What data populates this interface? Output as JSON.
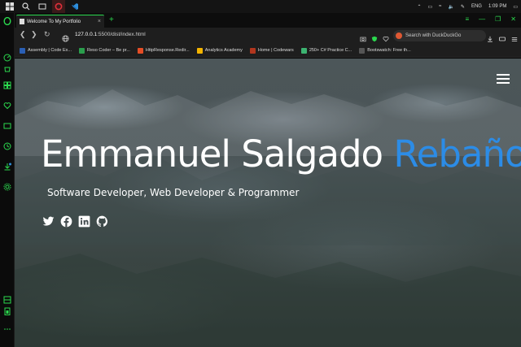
{
  "taskbar": {
    "language": "ENG",
    "time": "1:09 PM"
  },
  "tab": {
    "title": "Welcome To My Portfolio",
    "close": "×",
    "new_tab": "+"
  },
  "addressbar": {
    "url_host": "127.0.0.1",
    "url_path": ":5500/dist/index.html",
    "search_placeholder": "Search with DuckDuckGo"
  },
  "bookmarks": [
    {
      "label": "Assembly | Code Ex...",
      "color": "#2a5fb5"
    },
    {
      "label": "Reso Coder – Be pr...",
      "color": "#2a9d4c"
    },
    {
      "label": "HttpResponse.Redir...",
      "color": "#e44d26"
    },
    {
      "label": "Analytics Academy",
      "color": "#f4b400"
    },
    {
      "label": "Home | Codewars",
      "color": "#b1361e"
    },
    {
      "label": "250+ C# Practice C...",
      "color": "#3cb371"
    },
    {
      "label": "Bootswatch: Free th...",
      "color": "#555555"
    }
  ],
  "hero": {
    "first_name": "Emmanuel Salgado",
    "last_name": "Rebaño",
    "subtitle": "Software Developer, Web Developer & Programmer",
    "accent_color": "#2c8ce6"
  },
  "socials": [
    "twitter-icon",
    "facebook-icon",
    "linkedin-icon",
    "github-icon"
  ]
}
